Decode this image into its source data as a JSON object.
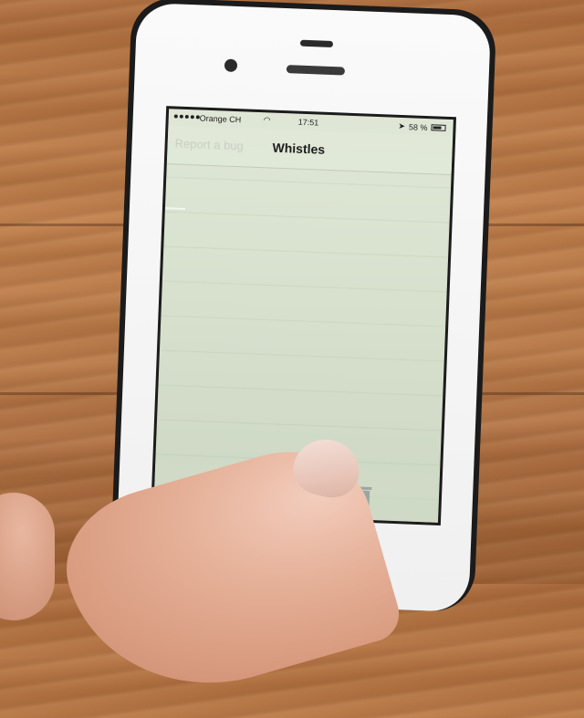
{
  "status_bar": {
    "carrier": "Orange CH",
    "wifi_icon": "wifi-icon",
    "time": "17:51",
    "battery": "58 %",
    "battery_icon": "battery-icon"
  },
  "nav_bar": {
    "back_label": "Report a bug",
    "title": "Whistles"
  },
  "toolbar": {
    "left_icon": "clipboard-icon",
    "right_icon": "trash-icon"
  },
  "colors": {
    "screen_bg": "#dfe6d6",
    "phone_bezel": "#fafafa",
    "wood": "#b06f3e"
  }
}
